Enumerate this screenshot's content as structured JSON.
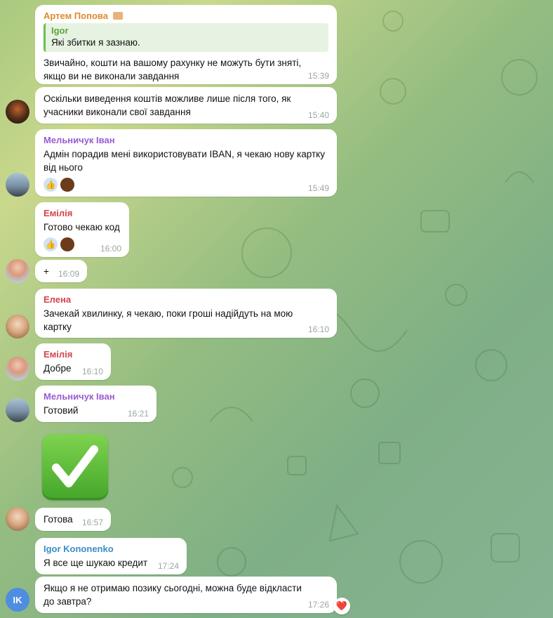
{
  "colors": {
    "sender_artem": "#e08a2b",
    "sender_melnychuk": "#9a5cd0",
    "sender_emilia": "#d4434b",
    "sender_elena": "#d4434b",
    "sender_igor": "#3a8cc7",
    "quote_accent": "#6cbe4e"
  },
  "messages": [
    {
      "sender": "Артем Попова",
      "quote_name": "Igor",
      "quote_text": "Які збитки я зазнаю.",
      "text": "Звичайно, кошти на вашому рахунку не можуть бути зняті, якщо ви не виконали завдання",
      "time": "15:39"
    },
    {
      "sender": "",
      "text": "Оскільки виведення коштів можливе лише після того, як учасники виконали свої завдання",
      "time": "15:40"
    },
    {
      "sender": "Мельничук Іван",
      "text": "Адмін порадив мені використовувати IBAN, я чекаю нову картку від нього",
      "time": "15:49"
    },
    {
      "sender": "Емілія",
      "text": "Готово чекаю код",
      "time": "16:00"
    },
    {
      "sender": "",
      "text": "+",
      "time": "16:09"
    },
    {
      "sender": "Елена",
      "text": "Зачекай хвилинку, я чекаю, поки гроші надійдуть на мою картку",
      "time": "16:10"
    },
    {
      "sender": "Емілія",
      "text": "Добре",
      "time": "16:10"
    },
    {
      "sender": "Мельничук Іван",
      "text": "Готовий",
      "time": "16:21"
    },
    {
      "sender": "",
      "text": "Готова",
      "time": "16:57"
    },
    {
      "sender": "Igor Kononenko",
      "text": "Я все ще шукаю кредит",
      "time": "17:24"
    },
    {
      "sender": "",
      "text": "Якщо я не отримаю позику сьогодні, можна буде відкласти до завтра?",
      "time": "17:26"
    }
  ],
  "reactions": {
    "thumb": "👍",
    "heart": "❤️"
  },
  "avatar_ik": "IK",
  "icons": {
    "sticker": "check-mark-sticker",
    "briefcase": "briefcase-emoji"
  }
}
